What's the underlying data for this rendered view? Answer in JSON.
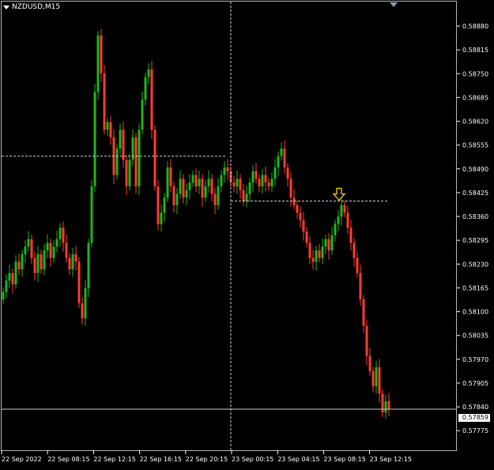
{
  "window": {
    "symbol_timeframe": "NZDUSD,M15",
    "current_price": "0.57859"
  },
  "colors": {
    "background": "#000000",
    "bull_candle": "#1fb51f",
    "bear_candle": "#ff3b30",
    "grid_text": "#ffffff",
    "crosshair": "#cfcfcf",
    "arrow": "#e6c200"
  },
  "chart_data": {
    "type": "candlestick",
    "y_ticks": [
      "0.58880",
      "0.58815",
      "0.58750",
      "0.58685",
      "0.58620",
      "0.58555",
      "0.58490",
      "0.58425",
      "0.58360",
      "0.58295",
      "0.58230",
      "0.58165",
      "0.58100",
      "0.58035",
      "0.57970",
      "0.57905",
      "0.57840",
      "0.57775"
    ],
    "x_ticks": [
      "22 Sep 2022",
      "22 Sep 08:15",
      "22 Sep 12:15",
      "22 Sep 16:15",
      "22 Sep 20:15",
      "23 Sep 00:15",
      "23 Sep 04:15",
      "23 Sep 08:15",
      "23 Sep 12:15"
    ],
    "ylim": [
      0.5775,
      0.5894
    ],
    "crosshair_price": 0.5853,
    "horizontal_lines": [
      0.58411,
      0.57859
    ],
    "arrow_icon": "down-arrow-icon",
    "close_prices": [
      0.5817,
      0.582,
      0.5822,
      0.5819,
      0.5825,
      0.5823,
      0.5827,
      0.5829,
      0.5831,
      0.5826,
      0.5822,
      0.5827,
      0.5823,
      0.5828,
      0.583,
      0.5826,
      0.5829,
      0.5831,
      0.5834,
      0.583,
      0.5826,
      0.5823,
      0.5827,
      0.5825,
      0.5814,
      0.581,
      0.5818,
      0.583,
      0.5845,
      0.587,
      0.5885,
      0.5875,
      0.586,
      0.5862,
      0.5858,
      0.5848,
      0.5855,
      0.586,
      0.5852,
      0.5845,
      0.5852,
      0.5858,
      0.5845,
      0.586,
      0.5868,
      0.5874,
      0.5876,
      0.586,
      0.5845,
      0.5835,
      0.5838,
      0.5842,
      0.585,
      0.5845,
      0.584,
      0.5843,
      0.5847,
      0.5842,
      0.5844,
      0.5846,
      0.5848,
      0.5845,
      0.5847,
      0.5842,
      0.5845,
      0.5847,
      0.5843,
      0.584,
      0.5845,
      0.5848,
      0.585,
      0.5849,
      0.5846,
      0.5845,
      0.5847,
      0.5844,
      0.5841,
      0.5843,
      0.5846,
      0.5849,
      0.5847,
      0.5845,
      0.5848,
      0.5846,
      0.5845,
      0.5847,
      0.585,
      0.5853,
      0.5855,
      0.585,
      0.5847,
      0.5842,
      0.584,
      0.5838,
      0.5836,
      0.5833,
      0.583,
      0.5826,
      0.5825,
      0.5828,
      0.5826,
      0.5829,
      0.5831,
      0.5828,
      0.5832,
      0.5835,
      0.5837,
      0.584,
      0.5838,
      0.5834,
      0.583,
      0.5826,
      0.5822,
      0.5815,
      0.5808,
      0.58,
      0.5796,
      0.5792,
      0.5797,
      0.579,
      0.5785,
      0.5788,
      0.5786
    ]
  }
}
